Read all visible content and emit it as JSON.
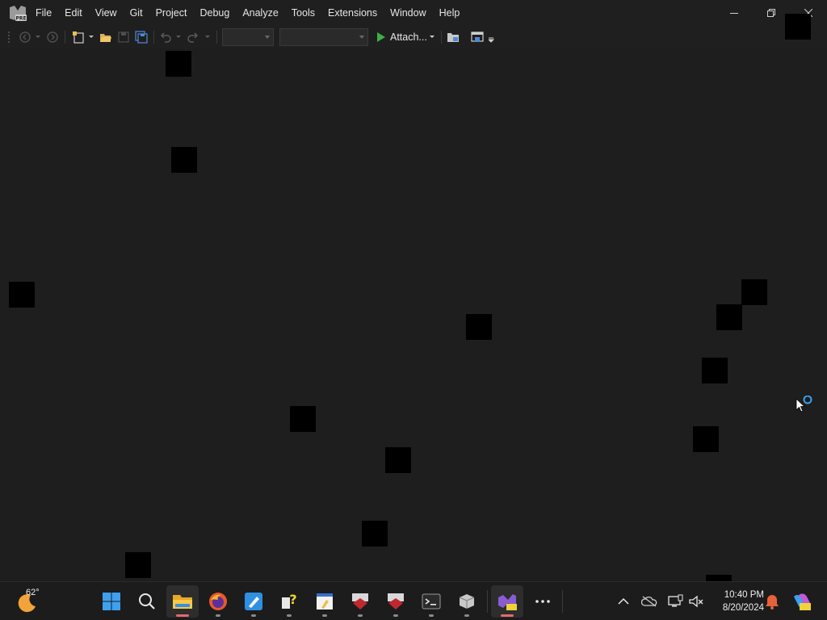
{
  "app": {
    "badge": "PRE",
    "menu": [
      "File",
      "Edit",
      "View",
      "Git",
      "Project",
      "Debug",
      "Analyze",
      "Tools",
      "Extensions",
      "Window",
      "Help"
    ]
  },
  "toolbar": {
    "attach_label": "Attach...",
    "config_combo_value": "",
    "platform_combo_value": ""
  },
  "taskbar": {
    "weather_temp": "62°",
    "apps": [
      "start-icon",
      "search-icon",
      "file-explorer-icon",
      "firefox-icon",
      "paint-icon",
      "help-tool-icon",
      "notepad-icon",
      "ruby-app-icon",
      "ruby-app-2-icon",
      "terminal-icon",
      "box-app-icon",
      "visual-studio-icon",
      "more-apps-icon"
    ],
    "clock_time": "10:40 PM",
    "clock_date": "8/20/2024"
  },
  "colors": {
    "background": "#1e1e1e",
    "menubar": "#1f1f1f",
    "taskbar": "#1c1c1c",
    "run_green": "#3cb043",
    "vs_purple": "#8a5cd1",
    "notification_orange": "#e8613a"
  }
}
